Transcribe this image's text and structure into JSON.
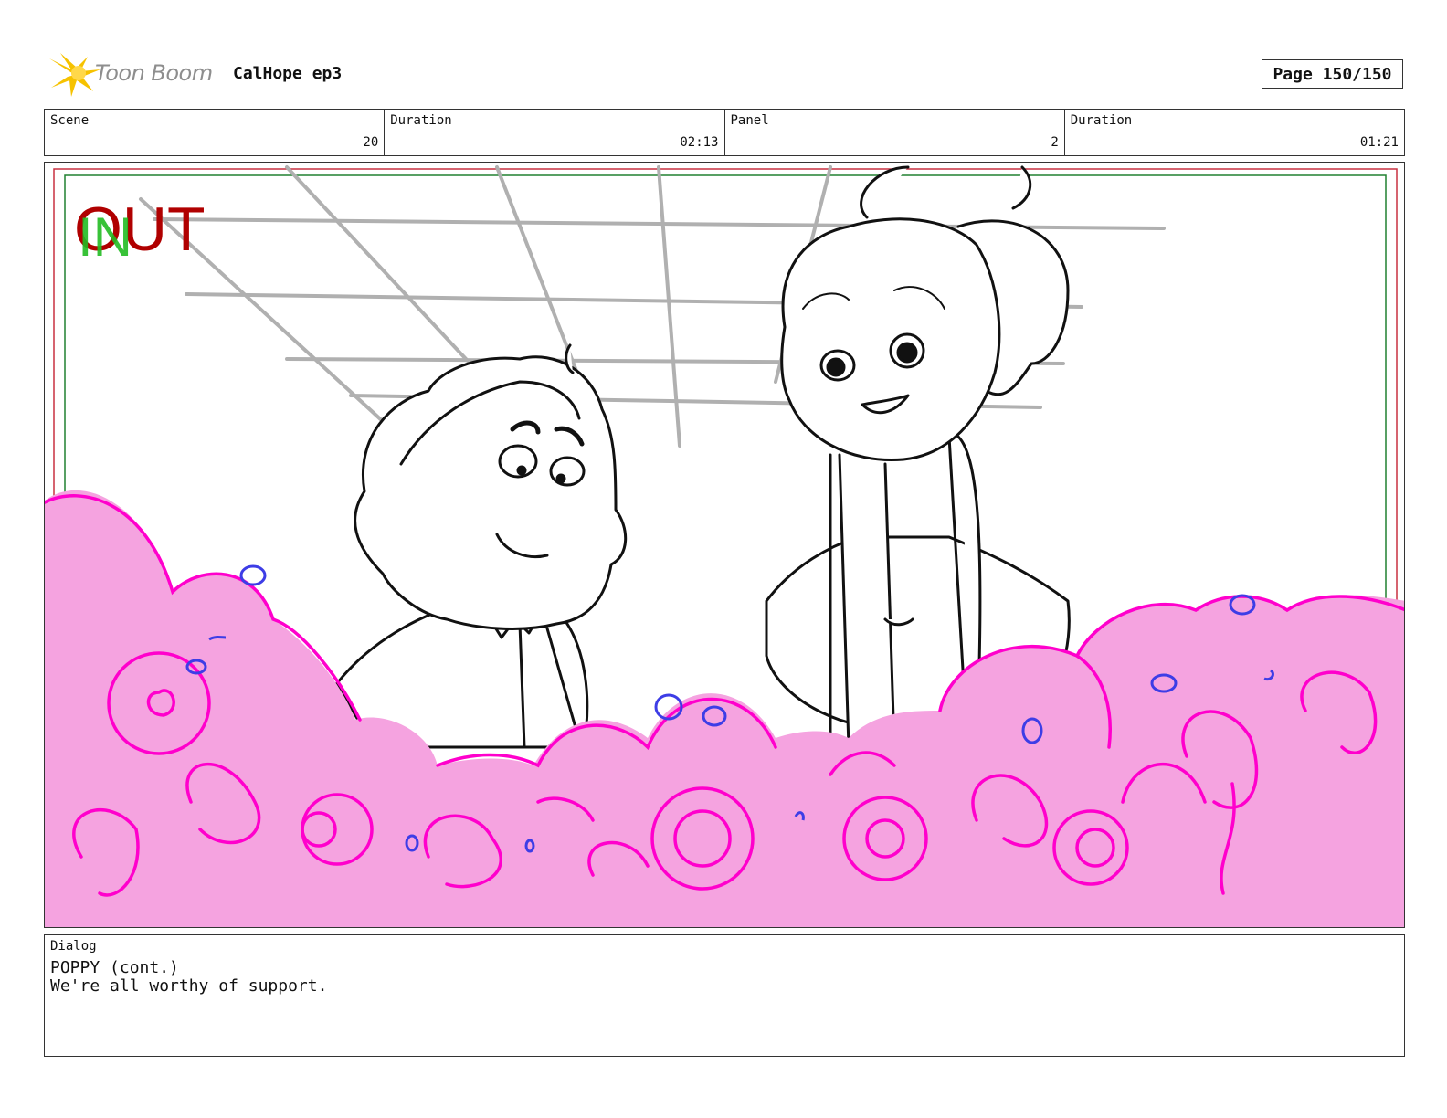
{
  "header": {
    "logo_text": "Toon Boom",
    "project": "CalHope ep3",
    "page": "Page 150/150"
  },
  "info": {
    "scene_label": "Scene",
    "scene_value": "20",
    "scene_duration_label": "Duration",
    "scene_duration_value": "02:13",
    "panel_label": "Panel",
    "panel_value": "2",
    "panel_duration_label": "Duration",
    "panel_duration_value": "01:21"
  },
  "panel_image": {
    "out_mark": "OUT",
    "in_mark": "IN",
    "colors": {
      "out_mark": "#b00000",
      "in_mark": "#22bb22",
      "cloud_fill": "#f5a3e0",
      "cloud_line": "#ff00cc",
      "bubble_line": "#3d3de6",
      "grid_line": "#b0b0b0",
      "safe_frame_red": "#c83040",
      "safe_frame_green": "#208030"
    }
  },
  "dialog": {
    "label": "Dialog",
    "lines": [
      "POPPY (cont.)",
      "We're all worthy of support."
    ]
  }
}
